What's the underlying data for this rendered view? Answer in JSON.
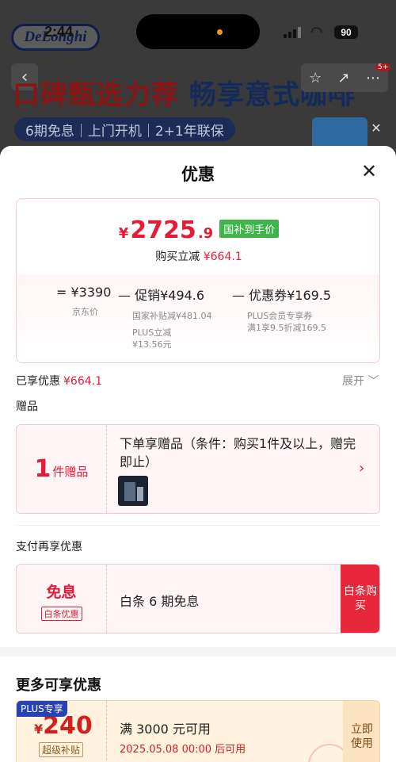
{
  "status_bar": {
    "time": "2:44",
    "battery": "90"
  },
  "background_page": {
    "logo": "DeLonghi",
    "headline_red": "口碑甄选力荐",
    "headline_blue": "畅享意式咖啡",
    "tagline": "6期免息｜上门开机｜2+1年联保",
    "cart_badge": "5+"
  },
  "sheet": {
    "title": "优惠",
    "price": {
      "currency": "¥",
      "integer": "2725",
      "decimal": ".9",
      "tag": "国补到手价",
      "instant_label": "购买立减",
      "instant_value": "¥664.1"
    },
    "calc": {
      "c1_main": "= ¥3390",
      "c1_sub": "京东价",
      "c2_main": "— 促销¥494.6",
      "c2_sub1": "国家补贴减¥481.04",
      "c2_sub2": "PLUS立减",
      "c2_sub3": "¥13.56元",
      "c3_main": "— 优惠券¥169.5",
      "c3_sub1": "PLUS会员专享券",
      "c3_sub2": "满1享9.5折减169.5"
    },
    "enjoyed_label": "已享优惠",
    "enjoyed_value": "¥664.1",
    "expand": "展开 ﹀",
    "gift_label": "赠品",
    "gift": {
      "count": "1",
      "unit": "件赠品",
      "text": "下单享赠品（条件：购买1件及以上，赠完即止）"
    },
    "pay_label": "支付再享优惠",
    "pay": {
      "title": "免息",
      "tag": "白条优惠",
      "text": "白条 6 期免息",
      "button": "白条购买"
    },
    "more_title": "更多可享优惠",
    "coupon": {
      "plus_tag": "PLUS专享",
      "currency": "¥",
      "amount": "240",
      "sub": "超级补贴",
      "condition": "满 3000 元可用",
      "date": "2025.05.08 00:00 后可用",
      "button": "立即使用"
    }
  }
}
